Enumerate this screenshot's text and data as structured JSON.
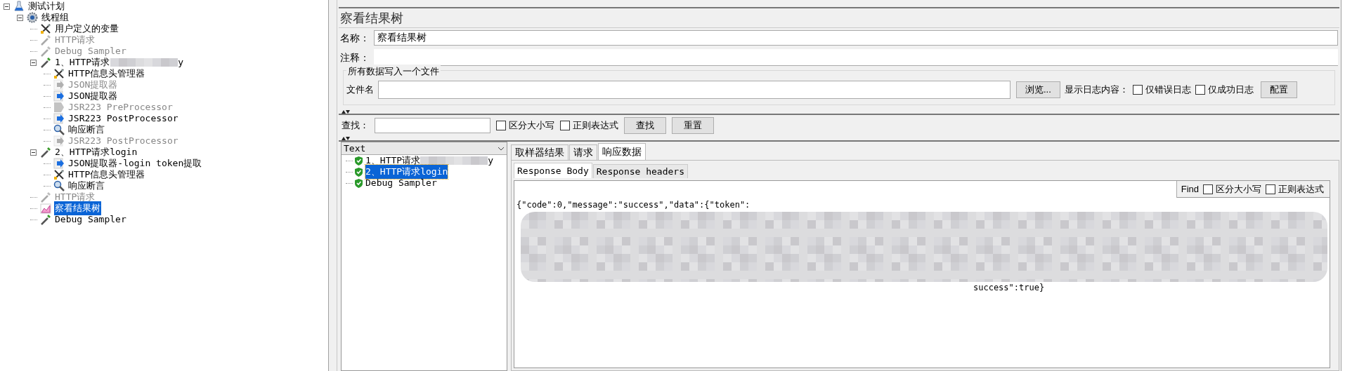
{
  "tree": [
    {
      "label": "测试计划",
      "kind": "plan",
      "disabled": false,
      "selected": false,
      "expanded": true,
      "children": [
        {
          "label": "线程组",
          "kind": "threads",
          "disabled": false,
          "selected": false,
          "expanded": true,
          "children": [
            {
              "label": "用户定义的变量",
              "kind": "config",
              "disabled": false,
              "selected": false
            },
            {
              "label": "HTTP请求",
              "kind": "sampler",
              "disabled": true,
              "selected": false
            },
            {
              "label": "Debug Sampler",
              "kind": "sampler",
              "disabled": true,
              "selected": false
            },
            {
              "label": "1、HTTP请求",
              "tail": "y",
              "redacted": true,
              "kind": "sampler",
              "disabled": false,
              "selected": false,
              "expanded": true,
              "children": [
                {
                  "label": "HTTP信息头管理器",
                  "kind": "config",
                  "disabled": false,
                  "selected": false
                },
                {
                  "label": "JSON提取器",
                  "kind": "post",
                  "disabled": true,
                  "selected": false
                },
                {
                  "label": "JSON提取器",
                  "kind": "post",
                  "disabled": false,
                  "selected": false
                },
                {
                  "label": "JSR223 PreProcessor",
                  "kind": "pre",
                  "disabled": true,
                  "selected": false
                },
                {
                  "label": "JSR223 PostProcessor",
                  "kind": "post",
                  "disabled": false,
                  "selected": false
                },
                {
                  "label": "响应断言",
                  "kind": "assertion",
                  "disabled": false,
                  "selected": false
                },
                {
                  "label": "JSR223 PostProcessor",
                  "kind": "post",
                  "disabled": true,
                  "selected": false
                }
              ]
            },
            {
              "label": "2、HTTP请求login",
              "kind": "sampler",
              "disabled": false,
              "selected": false,
              "expanded": true,
              "children": [
                {
                  "label": "JSON提取器-login token提取",
                  "kind": "post",
                  "disabled": false,
                  "selected": false
                },
                {
                  "label": "HTTP信息头管理器",
                  "kind": "config",
                  "disabled": false,
                  "selected": false
                },
                {
                  "label": "响应断言",
                  "kind": "assertion",
                  "disabled": false,
                  "selected": false
                }
              ]
            },
            {
              "label": "HTTP请求",
              "kind": "sampler",
              "disabled": true,
              "selected": false
            },
            {
              "label": "察看结果树",
              "kind": "listener",
              "disabled": false,
              "selected": true
            },
            {
              "label": "Debug Sampler",
              "kind": "sampler",
              "disabled": false,
              "selected": false
            }
          ]
        }
      ]
    }
  ],
  "editor": {
    "title": "察看结果树",
    "name_label": "名称：",
    "name_value": "察看结果树",
    "comment_label": "注释：",
    "file_group": {
      "legend": "所有数据写入一个文件",
      "file_label": "文件名",
      "browse": "浏览...",
      "log_label": "显示日志内容：",
      "checks": [
        {
          "label": "仅错误日志",
          "checked": false
        },
        {
          "label": "仅成功日志",
          "checked": false
        }
      ],
      "config": "配置"
    },
    "search": {
      "label": "查找：",
      "checks": [
        {
          "label": "区分大小写",
          "checked": false
        },
        {
          "label": "正则表达式",
          "checked": false
        }
      ],
      "buttons": [
        "查找",
        "重置"
      ]
    },
    "renderer": "Text",
    "results": [
      {
        "label": "1、HTTP请求",
        "tail": "y",
        "redacted": true,
        "selected": false
      },
      {
        "label": "2、HTTP请求login",
        "selected": true
      },
      {
        "label": "Debug Sampler",
        "selected": false
      }
    ],
    "tabs": [
      {
        "label": "取样器结果",
        "selected": false
      },
      {
        "label": "请求",
        "selected": false
      },
      {
        "label": "响应数据",
        "selected": true
      }
    ],
    "subtabs": [
      {
        "label": "Response Body",
        "selected": true
      },
      {
        "label": "Response headers",
        "selected": false
      }
    ],
    "find": {
      "label": "Find",
      "checks": [
        {
          "label": "区分大小写",
          "checked": false
        },
        {
          "label": "正则表达式",
          "checked": false
        }
      ]
    },
    "response": {
      "first": "{\"code\":0,\"message\":\"success\",\"data\":{\"token\":",
      "last": "success\":true}",
      "redacted": true
    }
  }
}
